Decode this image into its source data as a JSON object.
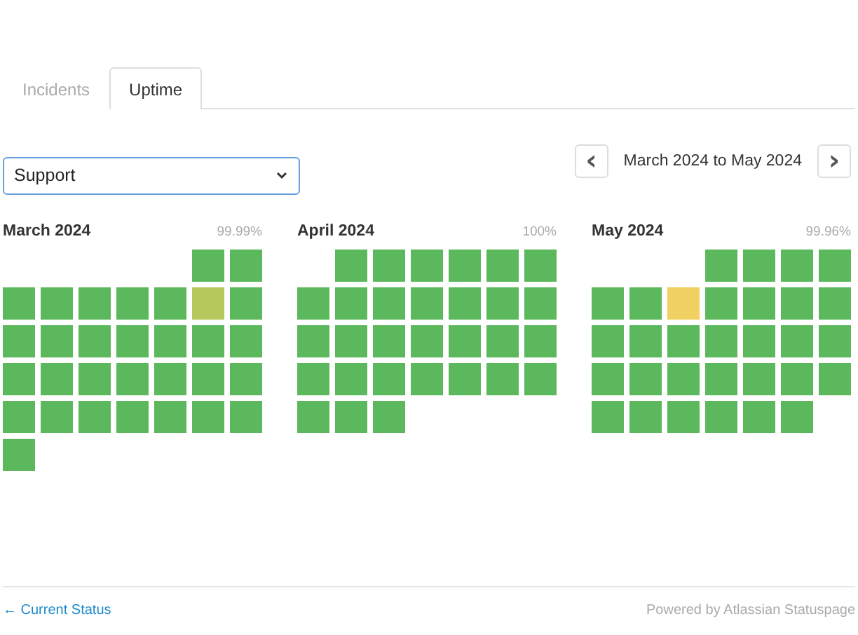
{
  "tabs": [
    {
      "label": "Incidents",
      "selected": false
    },
    {
      "label": "Uptime",
      "selected": true
    }
  ],
  "component_select": {
    "value": "Support"
  },
  "date_range": {
    "prev": "‹",
    "label": "March 2024 to May 2024",
    "next": "›"
  },
  "months": [
    {
      "title": "March 2024",
      "uptime": "99.99%",
      "days": [
        {
          "kind": "blank"
        },
        {
          "kind": "blank"
        },
        {
          "kind": "blank"
        },
        {
          "kind": "blank"
        },
        {
          "kind": "blank"
        },
        {
          "kind": "day",
          "color": "#5cb85c"
        },
        {
          "kind": "day",
          "color": "#5cb85c"
        },
        {
          "kind": "day",
          "color": "#5cb85c"
        },
        {
          "kind": "day",
          "color": "#5cb85c"
        },
        {
          "kind": "day",
          "color": "#5cb85c"
        },
        {
          "kind": "day",
          "color": "#5cb85c"
        },
        {
          "kind": "day",
          "color": "#5cb85c"
        },
        {
          "kind": "day",
          "color": "#b6c85c"
        },
        {
          "kind": "day",
          "color": "#5cb85c"
        },
        {
          "kind": "day",
          "color": "#5cb85c"
        },
        {
          "kind": "day",
          "color": "#5cb85c"
        },
        {
          "kind": "day",
          "color": "#5cb85c"
        },
        {
          "kind": "day",
          "color": "#5cb85c"
        },
        {
          "kind": "day",
          "color": "#5cb85c"
        },
        {
          "kind": "day",
          "color": "#5cb85c"
        },
        {
          "kind": "day",
          "color": "#5cb85c"
        },
        {
          "kind": "day",
          "color": "#5cb85c"
        },
        {
          "kind": "day",
          "color": "#5cb85c"
        },
        {
          "kind": "day",
          "color": "#5cb85c"
        },
        {
          "kind": "day",
          "color": "#5cb85c"
        },
        {
          "kind": "day",
          "color": "#5cb85c"
        },
        {
          "kind": "day",
          "color": "#5cb85c"
        },
        {
          "kind": "day",
          "color": "#5cb85c"
        },
        {
          "kind": "day",
          "color": "#5cb85c"
        },
        {
          "kind": "day",
          "color": "#5cb85c"
        },
        {
          "kind": "day",
          "color": "#5cb85c"
        },
        {
          "kind": "day",
          "color": "#5cb85c"
        },
        {
          "kind": "day",
          "color": "#5cb85c"
        },
        {
          "kind": "day",
          "color": "#5cb85c"
        },
        {
          "kind": "day",
          "color": "#5cb85c"
        },
        {
          "kind": "day",
          "color": "#5cb85c"
        }
      ]
    },
    {
      "title": "April 2024",
      "uptime": "100%",
      "days": [
        {
          "kind": "blank"
        },
        {
          "kind": "day",
          "color": "#5cb85c"
        },
        {
          "kind": "day",
          "color": "#5cb85c"
        },
        {
          "kind": "day",
          "color": "#5cb85c"
        },
        {
          "kind": "day",
          "color": "#5cb85c"
        },
        {
          "kind": "day",
          "color": "#5cb85c"
        },
        {
          "kind": "day",
          "color": "#5cb85c"
        },
        {
          "kind": "day",
          "color": "#5cb85c"
        },
        {
          "kind": "day",
          "color": "#5cb85c"
        },
        {
          "kind": "day",
          "color": "#5cb85c"
        },
        {
          "kind": "day",
          "color": "#5cb85c"
        },
        {
          "kind": "day",
          "color": "#5cb85c"
        },
        {
          "kind": "day",
          "color": "#5cb85c"
        },
        {
          "kind": "day",
          "color": "#5cb85c"
        },
        {
          "kind": "day",
          "color": "#5cb85c"
        },
        {
          "kind": "day",
          "color": "#5cb85c"
        },
        {
          "kind": "day",
          "color": "#5cb85c"
        },
        {
          "kind": "day",
          "color": "#5cb85c"
        },
        {
          "kind": "day",
          "color": "#5cb85c"
        },
        {
          "kind": "day",
          "color": "#5cb85c"
        },
        {
          "kind": "day",
          "color": "#5cb85c"
        },
        {
          "kind": "day",
          "color": "#5cb85c"
        },
        {
          "kind": "day",
          "color": "#5cb85c"
        },
        {
          "kind": "day",
          "color": "#5cb85c"
        },
        {
          "kind": "day",
          "color": "#5cb85c"
        },
        {
          "kind": "day",
          "color": "#5cb85c"
        },
        {
          "kind": "day",
          "color": "#5cb85c"
        },
        {
          "kind": "day",
          "color": "#5cb85c"
        },
        {
          "kind": "day",
          "color": "#5cb85c"
        },
        {
          "kind": "day",
          "color": "#5cb85c"
        },
        {
          "kind": "day",
          "color": "#5cb85c"
        }
      ]
    },
    {
      "title": "May 2024",
      "uptime": "99.96%",
      "days": [
        {
          "kind": "blank"
        },
        {
          "kind": "blank"
        },
        {
          "kind": "blank"
        },
        {
          "kind": "day",
          "color": "#5cb85c"
        },
        {
          "kind": "day",
          "color": "#5cb85c"
        },
        {
          "kind": "day",
          "color": "#5cb85c"
        },
        {
          "kind": "day",
          "color": "#5cb85c"
        },
        {
          "kind": "day",
          "color": "#5cb85c"
        },
        {
          "kind": "day",
          "color": "#5cb85c"
        },
        {
          "kind": "day",
          "color": "#f0d060"
        },
        {
          "kind": "day",
          "color": "#5cb85c"
        },
        {
          "kind": "day",
          "color": "#5cb85c"
        },
        {
          "kind": "day",
          "color": "#5cb85c"
        },
        {
          "kind": "day",
          "color": "#5cb85c"
        },
        {
          "kind": "day",
          "color": "#5cb85c"
        },
        {
          "kind": "day",
          "color": "#5cb85c"
        },
        {
          "kind": "day",
          "color": "#5cb85c"
        },
        {
          "kind": "day",
          "color": "#5cb85c"
        },
        {
          "kind": "day",
          "color": "#5cb85c"
        },
        {
          "kind": "day",
          "color": "#5cb85c"
        },
        {
          "kind": "day",
          "color": "#5cb85c"
        },
        {
          "kind": "day",
          "color": "#5cb85c"
        },
        {
          "kind": "day",
          "color": "#5cb85c"
        },
        {
          "kind": "day",
          "color": "#5cb85c"
        },
        {
          "kind": "day",
          "color": "#5cb85c"
        },
        {
          "kind": "day",
          "color": "#5cb85c"
        },
        {
          "kind": "day",
          "color": "#5cb85c"
        },
        {
          "kind": "day",
          "color": "#5cb85c"
        },
        {
          "kind": "day",
          "color": "#5cb85c"
        },
        {
          "kind": "day",
          "color": "#5cb85c"
        },
        {
          "kind": "day",
          "color": "#5cb85c"
        },
        {
          "kind": "day",
          "color": "#5cb85c"
        },
        {
          "kind": "day",
          "color": "#5cb85c"
        },
        {
          "kind": "day",
          "color": "#5cb85c"
        }
      ]
    }
  ],
  "footer": {
    "back_link": "← Current Status",
    "powered_by": "Powered by Atlassian Statuspage"
  }
}
